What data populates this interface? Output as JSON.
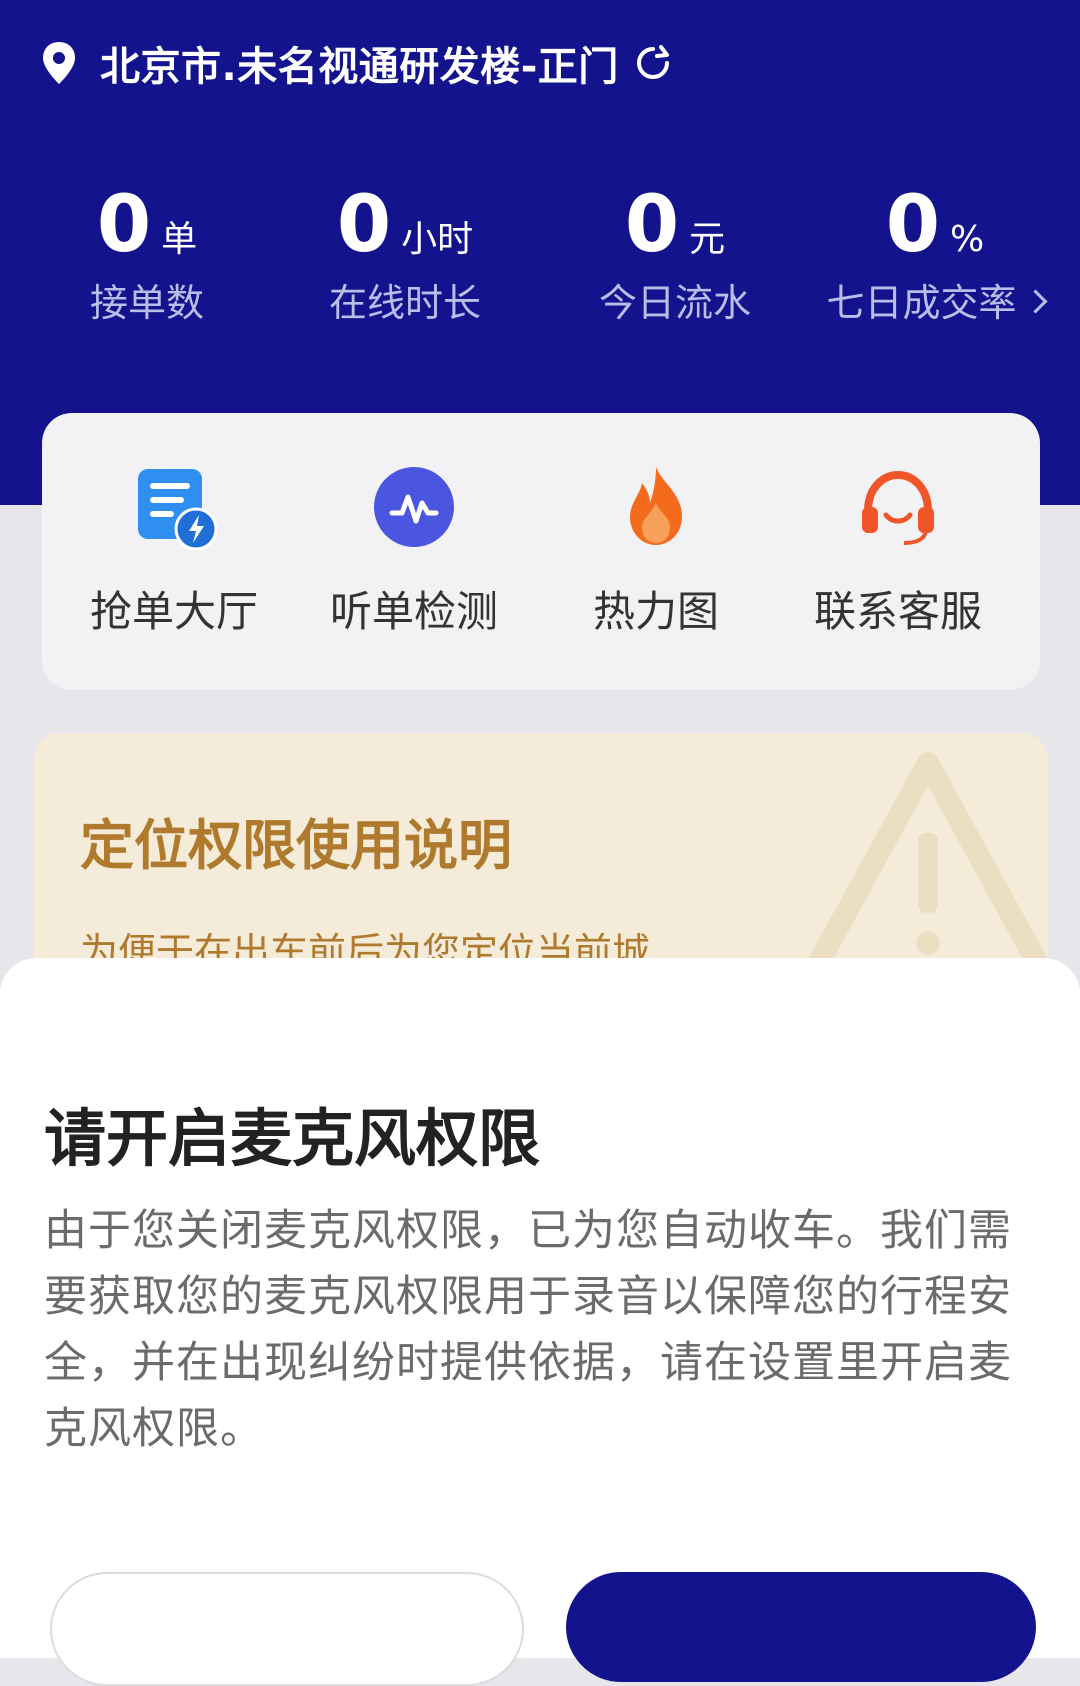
{
  "header": {
    "location": "北京市.未名视通研发楼-正门"
  },
  "stats": [
    {
      "value": "0",
      "unit": "单",
      "label": "接单数"
    },
    {
      "value": "0",
      "unit": "小时",
      "label": "在线时长"
    },
    {
      "value": "0",
      "unit": "元",
      "label": "今日流水"
    },
    {
      "value": "0",
      "unit": "%",
      "label": "七日成交率"
    }
  ],
  "quick_actions": [
    {
      "label": "抢单大厅",
      "icon": "order-hall-icon"
    },
    {
      "label": "听单检测",
      "icon": "audio-wave-icon"
    },
    {
      "label": "热力图",
      "icon": "flame-icon"
    },
    {
      "label": "联系客服",
      "icon": "headset-icon"
    }
  ],
  "notice": {
    "title": "定位权限使用说明",
    "text": "为便于在出车前后为您定位当前城"
  },
  "dialog": {
    "title": "请开启麦克风权限",
    "body": "由于您关闭麦克风权限，已为您自动收车。我们需要获取您的麦克风权限用于录音以保障您的行程安全，并在出现纠纷时提供依据，请在设置里开启麦克风权限。",
    "cancel_label": "",
    "confirm_label": ""
  },
  "colors": {
    "header_bg": "#13138e",
    "stat_label": "#b9bde8",
    "notice_text": "#b07a2e",
    "primary_button": "#13138e"
  }
}
